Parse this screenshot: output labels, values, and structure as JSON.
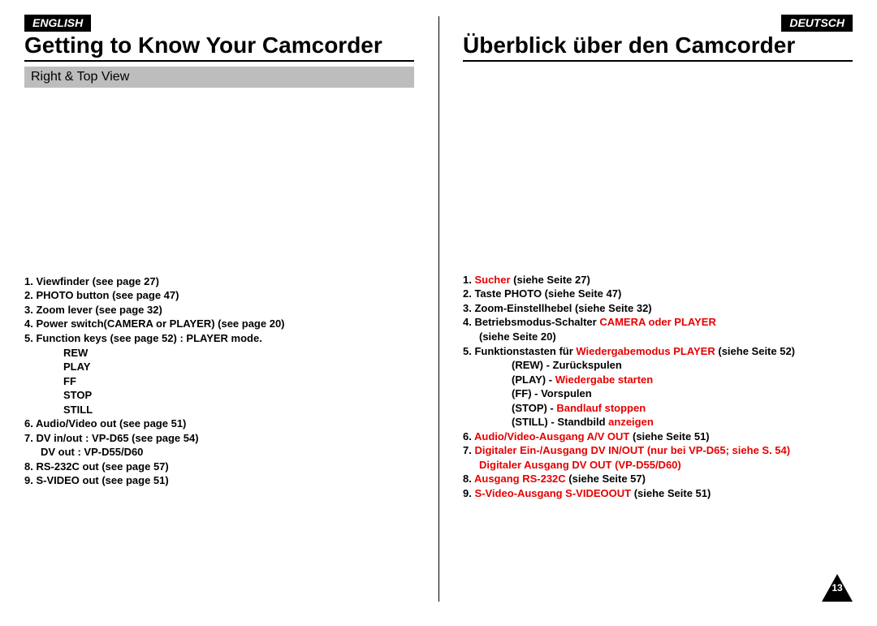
{
  "left": {
    "lang": "ENGLISH",
    "title": "Getting to Know Your Camcorder",
    "subhead": "Right & Top View",
    "list": {
      "l1": "1.  Viewfinder (see page 27)",
      "l2": "2.  PHOTO button (see page 47)",
      "l3": "3.  Zoom lever (see page 32)",
      "l4": "4.  Power switch(CAMERA or PLAYER) (see page 20)",
      "l5": "5.  Function keys (see page 52) : PLAYER mode.",
      "l5a": "REW",
      "l5b": "PLAY",
      "l5c": "FF",
      "l5d": "STOP",
      "l5e": "STILL",
      "l6": "6.  Audio/Video out (see page 51)",
      "l7": "7.  DV in/out : VP-D65 (see page 54)",
      "l7b": "DV out      : VP-D55/D60",
      "l8": "8.  RS-232C out (see page 57)",
      "l9": "9.  S-VIDEO out (see page 51)"
    }
  },
  "right": {
    "lang": "DEUTSCH",
    "title": "Überblick über den Camcorder",
    "list": {
      "r1a": "1.  ",
      "r1b": "Sucher ",
      "r1c": "(siehe Seite 27)",
      "r2": "2.  Taste PHOTO (siehe Seite 47)",
      "r3": "3.  Zoom-Einstellhebel (siehe Seite 32)",
      "r4a": "4.  Betriebsmodus-Schalter ",
      "r4b": "CAMERA oder PLAYER",
      "r4c": "(siehe Seite 20)",
      "r5a": "5.  Funktionstasten für ",
      "r5b": "Wiedergabemodus PLAYER ",
      "r5c": "(siehe Seite 52)",
      "r5d": "(REW) - Zurückspulen",
      "r5e1": "(PLAY) - ",
      "r5e2": "Wiedergabe starten",
      "r5f": "(FF) - Vorspulen",
      "r5g1": "(STOP) - ",
      "r5g2": "Bandlauf stoppen",
      "r5h1": "(STILL) - Standbild ",
      "r5h2": "anzeigen",
      "r6a": "6.  ",
      "r6b": "Audio/Video-Ausgang A/V OUT ",
      "r6c": "(siehe Seite 51)",
      "r7a": "7.  ",
      "r7b": "Digitaler Ein-/Ausgang DV IN/OUT (nur bei VP-D65; siehe S. 54)",
      "r7c": "Digitaler Ausgang DV OUT (VP-D55/D60)",
      "r8a": "8.  ",
      "r8b": "Ausgang RS-232C ",
      "r8c": "(siehe Seite 57)",
      "r9a": "9.  ",
      "r9b": "S-Video-Ausgang  S-VIDEOOUT ",
      "r9c": "(siehe Seite 51)"
    }
  },
  "page_number": "13"
}
